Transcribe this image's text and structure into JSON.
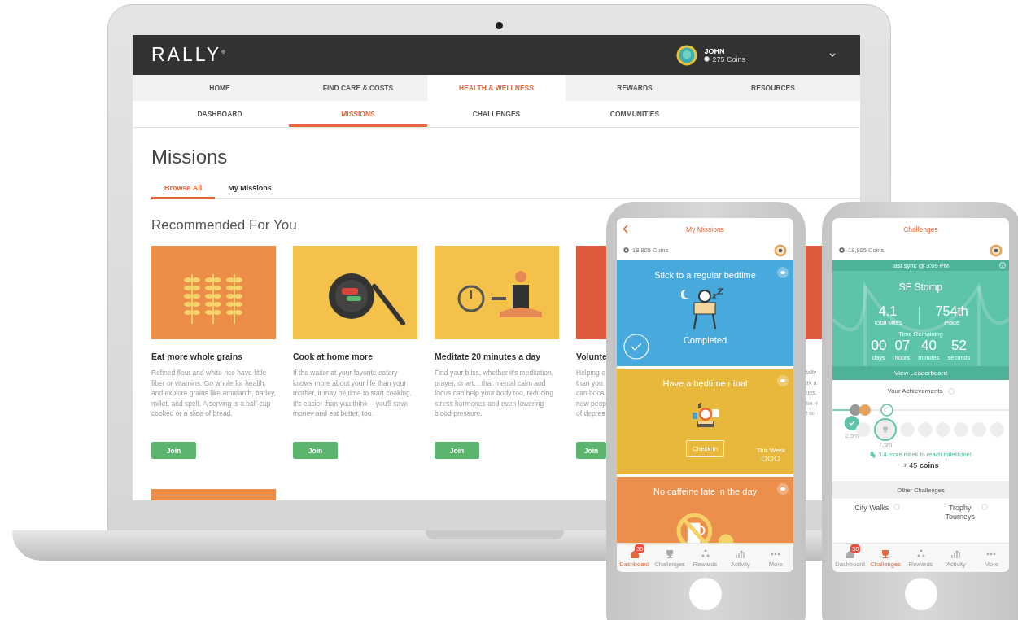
{
  "laptop": {
    "header": {
      "logo": "RALLY",
      "logo_mark": "®",
      "user_name": "JOHN",
      "coins": "275 Coins"
    },
    "nav": [
      {
        "label": "HOME",
        "selected": false
      },
      {
        "label": "FIND CARE & COSTS",
        "selected": false
      },
      {
        "label": "HEALTH & WELLNESS",
        "selected": true
      },
      {
        "label": "REWARDS",
        "selected": false
      },
      {
        "label": "RESOURCES",
        "selected": false
      }
    ],
    "subnav": [
      {
        "label": "DASHBOARD",
        "selected": false
      },
      {
        "label": "MISSIONS",
        "selected": true
      },
      {
        "label": "CHALLENGES",
        "selected": false
      },
      {
        "label": "COMMUNITIES",
        "selected": false
      }
    ],
    "page_title": "Missions",
    "tabs": [
      {
        "label": "Browse All",
        "selected": true
      },
      {
        "label": "My Missions",
        "selected": false
      }
    ],
    "section_title": "Recommended For You",
    "cards": [
      {
        "kind": "full",
        "title": "Eat more whole grains",
        "description": "Refined flour and white rice have little fiber or vitamins. Go whole for health, and explore grains like amaranth, barley, millet, and spelt. A serving is a half-cup cooked or a slice of bread.",
        "button": "Join"
      },
      {
        "kind": "full",
        "title": "Cook at home more",
        "description": "If the waiter at your favorite eatery knows more about your life than your mother, it may be time to start cooking. It's easier than you think -- you'll save money and eat better, too.",
        "button": "Join"
      },
      {
        "kind": "full",
        "title": "Meditate 20 minutes a day",
        "description": "Find your bliss, whether it's meditation, prayer, or art... that mental calm and focus can help your body too, reducing stress hormones and even lowering blood pressure.",
        "button": "Join"
      },
      {
        "kind": "clipped",
        "title": "Volunte",
        "lines": [
          "Helping o",
          "than you",
          "can boos",
          "new peop",
          "of depres"
        ],
        "button": "Join"
      },
      {
        "kind": "sliver",
        "lines": [
          "tally",
          "ity a",
          "ries,",
          "be p",
          "t so"
        ]
      }
    ]
  },
  "phones": [
    {
      "kind": "missions",
      "title": "My Missions",
      "coins": "18,805 Coins",
      "missions": [
        {
          "title": "Stick to a regular bedtime",
          "color": "#48a9dc",
          "completed": true,
          "status": "Completed"
        },
        {
          "title": "Have a bedtime ritual",
          "color": "#e7b83c",
          "completed": false,
          "button": "Check In",
          "week_label": "This Week"
        },
        {
          "title": "No caffeine late in the day",
          "color": "#ed8f4c",
          "completed": false
        }
      ],
      "tabs": [
        {
          "label": "Dashboard",
          "selected": true,
          "badge": "30"
        },
        {
          "label": "Challenges",
          "selected": false
        },
        {
          "label": "Rewards",
          "selected": false
        },
        {
          "label": "Activity",
          "selected": false
        },
        {
          "label": "More",
          "selected": false
        }
      ]
    },
    {
      "kind": "challenges",
      "title": "Challenges",
      "coins": "18,805 Coins",
      "challenge": {
        "sync": "last sync @ 3:09 PM",
        "name": "SF Stomp",
        "stats": [
          {
            "value": "4.1",
            "label": "Total Miles"
          },
          {
            "value": "754th",
            "label": "Place"
          }
        ],
        "time_label": "Time Remaining",
        "countdown": [
          {
            "value": "00",
            "unit": "days"
          },
          {
            "value": "07",
            "unit": "hours"
          },
          {
            "value": "40",
            "unit": "minutes"
          },
          {
            "value": "52",
            "unit": "seconds"
          }
        ],
        "leaderboard": "View Leaderboard"
      },
      "achievements_title": "Your Achievements",
      "milestones": [
        {
          "kind": "done",
          "label": "2.5m"
        },
        {
          "kind": "pending"
        },
        {
          "kind": "current",
          "label": "7.5m"
        },
        {
          "kind": "pending"
        },
        {
          "kind": "pending"
        },
        {
          "kind": "pending"
        },
        {
          "kind": "pending"
        },
        {
          "kind": "pending"
        },
        {
          "kind": "pending"
        }
      ],
      "milestone_note": "3.4 more miles to reach milestone!",
      "reward": "+ 45 **coins**",
      "other_title": "Other Challenges",
      "others": [
        "City Walks",
        "Trophy Tourneys"
      ],
      "tabs": [
        {
          "label": "Dashboard",
          "selected": false,
          "badge": "30"
        },
        {
          "label": "Challenges",
          "selected": true
        },
        {
          "label": "Rewards",
          "selected": false
        },
        {
          "label": "Activity",
          "selected": false
        },
        {
          "label": "More",
          "selected": false
        }
      ]
    }
  ]
}
